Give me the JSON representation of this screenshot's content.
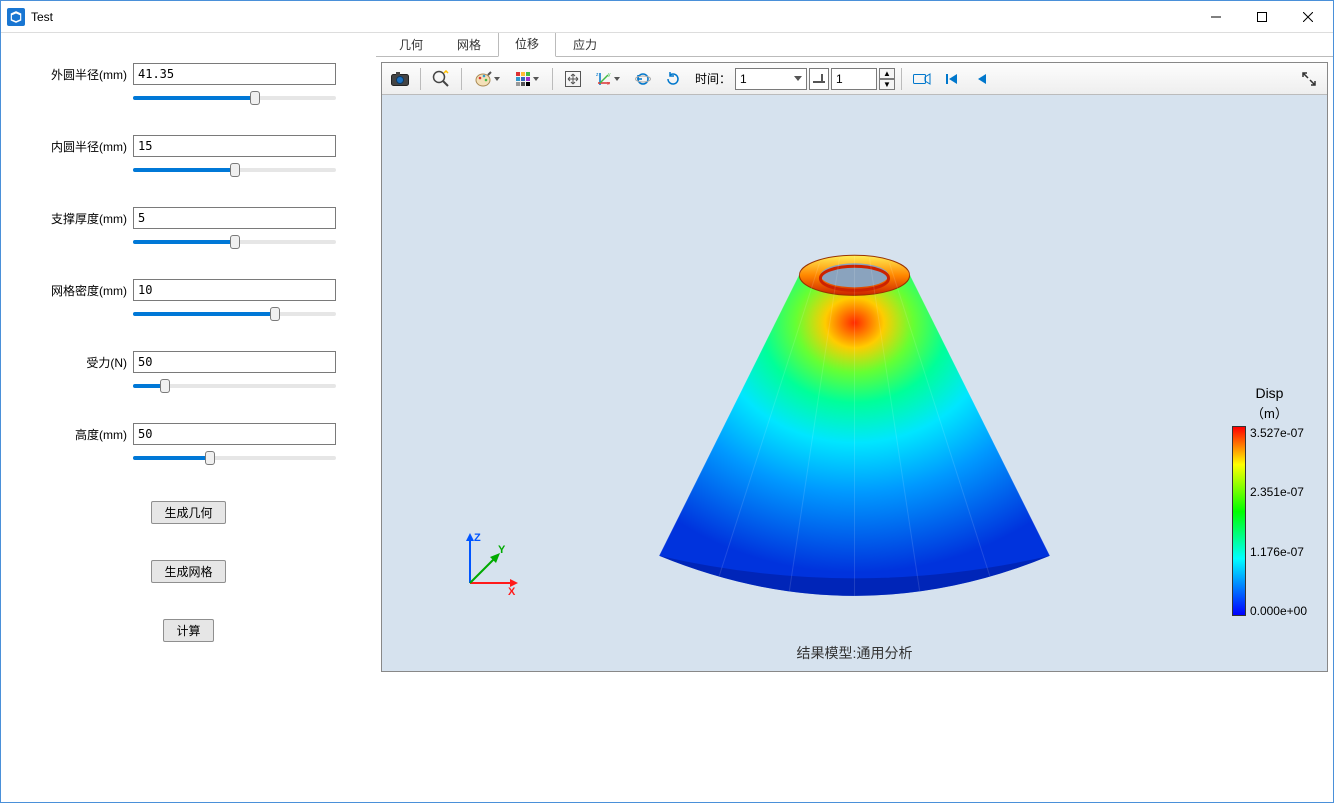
{
  "window": {
    "title": "Test"
  },
  "params": [
    {
      "label": "外圆半径(mm)",
      "value": "41.35",
      "pct": 60
    },
    {
      "label": "内圆半径(mm)",
      "value": "15",
      "pct": 50
    },
    {
      "label": "支撑厚度(mm)",
      "value": "5",
      "pct": 50
    },
    {
      "label": "网格密度(mm)",
      "value": "10",
      "pct": 70
    },
    {
      "label": "受力(N)",
      "value": "50",
      "pct": 16
    },
    {
      "label": "高度(mm)",
      "value": "50",
      "pct": 38
    }
  ],
  "buttons": {
    "gen_geom": "生成几何",
    "gen_mesh": "生成网格",
    "compute": "计算"
  },
  "tabs": [
    "几何",
    "网格",
    "位移",
    "应力"
  ],
  "active_tab": 2,
  "toolbar": {
    "time_label": "时间：",
    "time_dropdown": "1",
    "frame_input": "1"
  },
  "viewer": {
    "caption": "结果模型:通用分析",
    "legend_title": "Disp",
    "legend_unit": "（m）",
    "legend_ticks": [
      "3.527e-07",
      "2.351e-07",
      "1.176e-07",
      "0.000e+00"
    ]
  }
}
